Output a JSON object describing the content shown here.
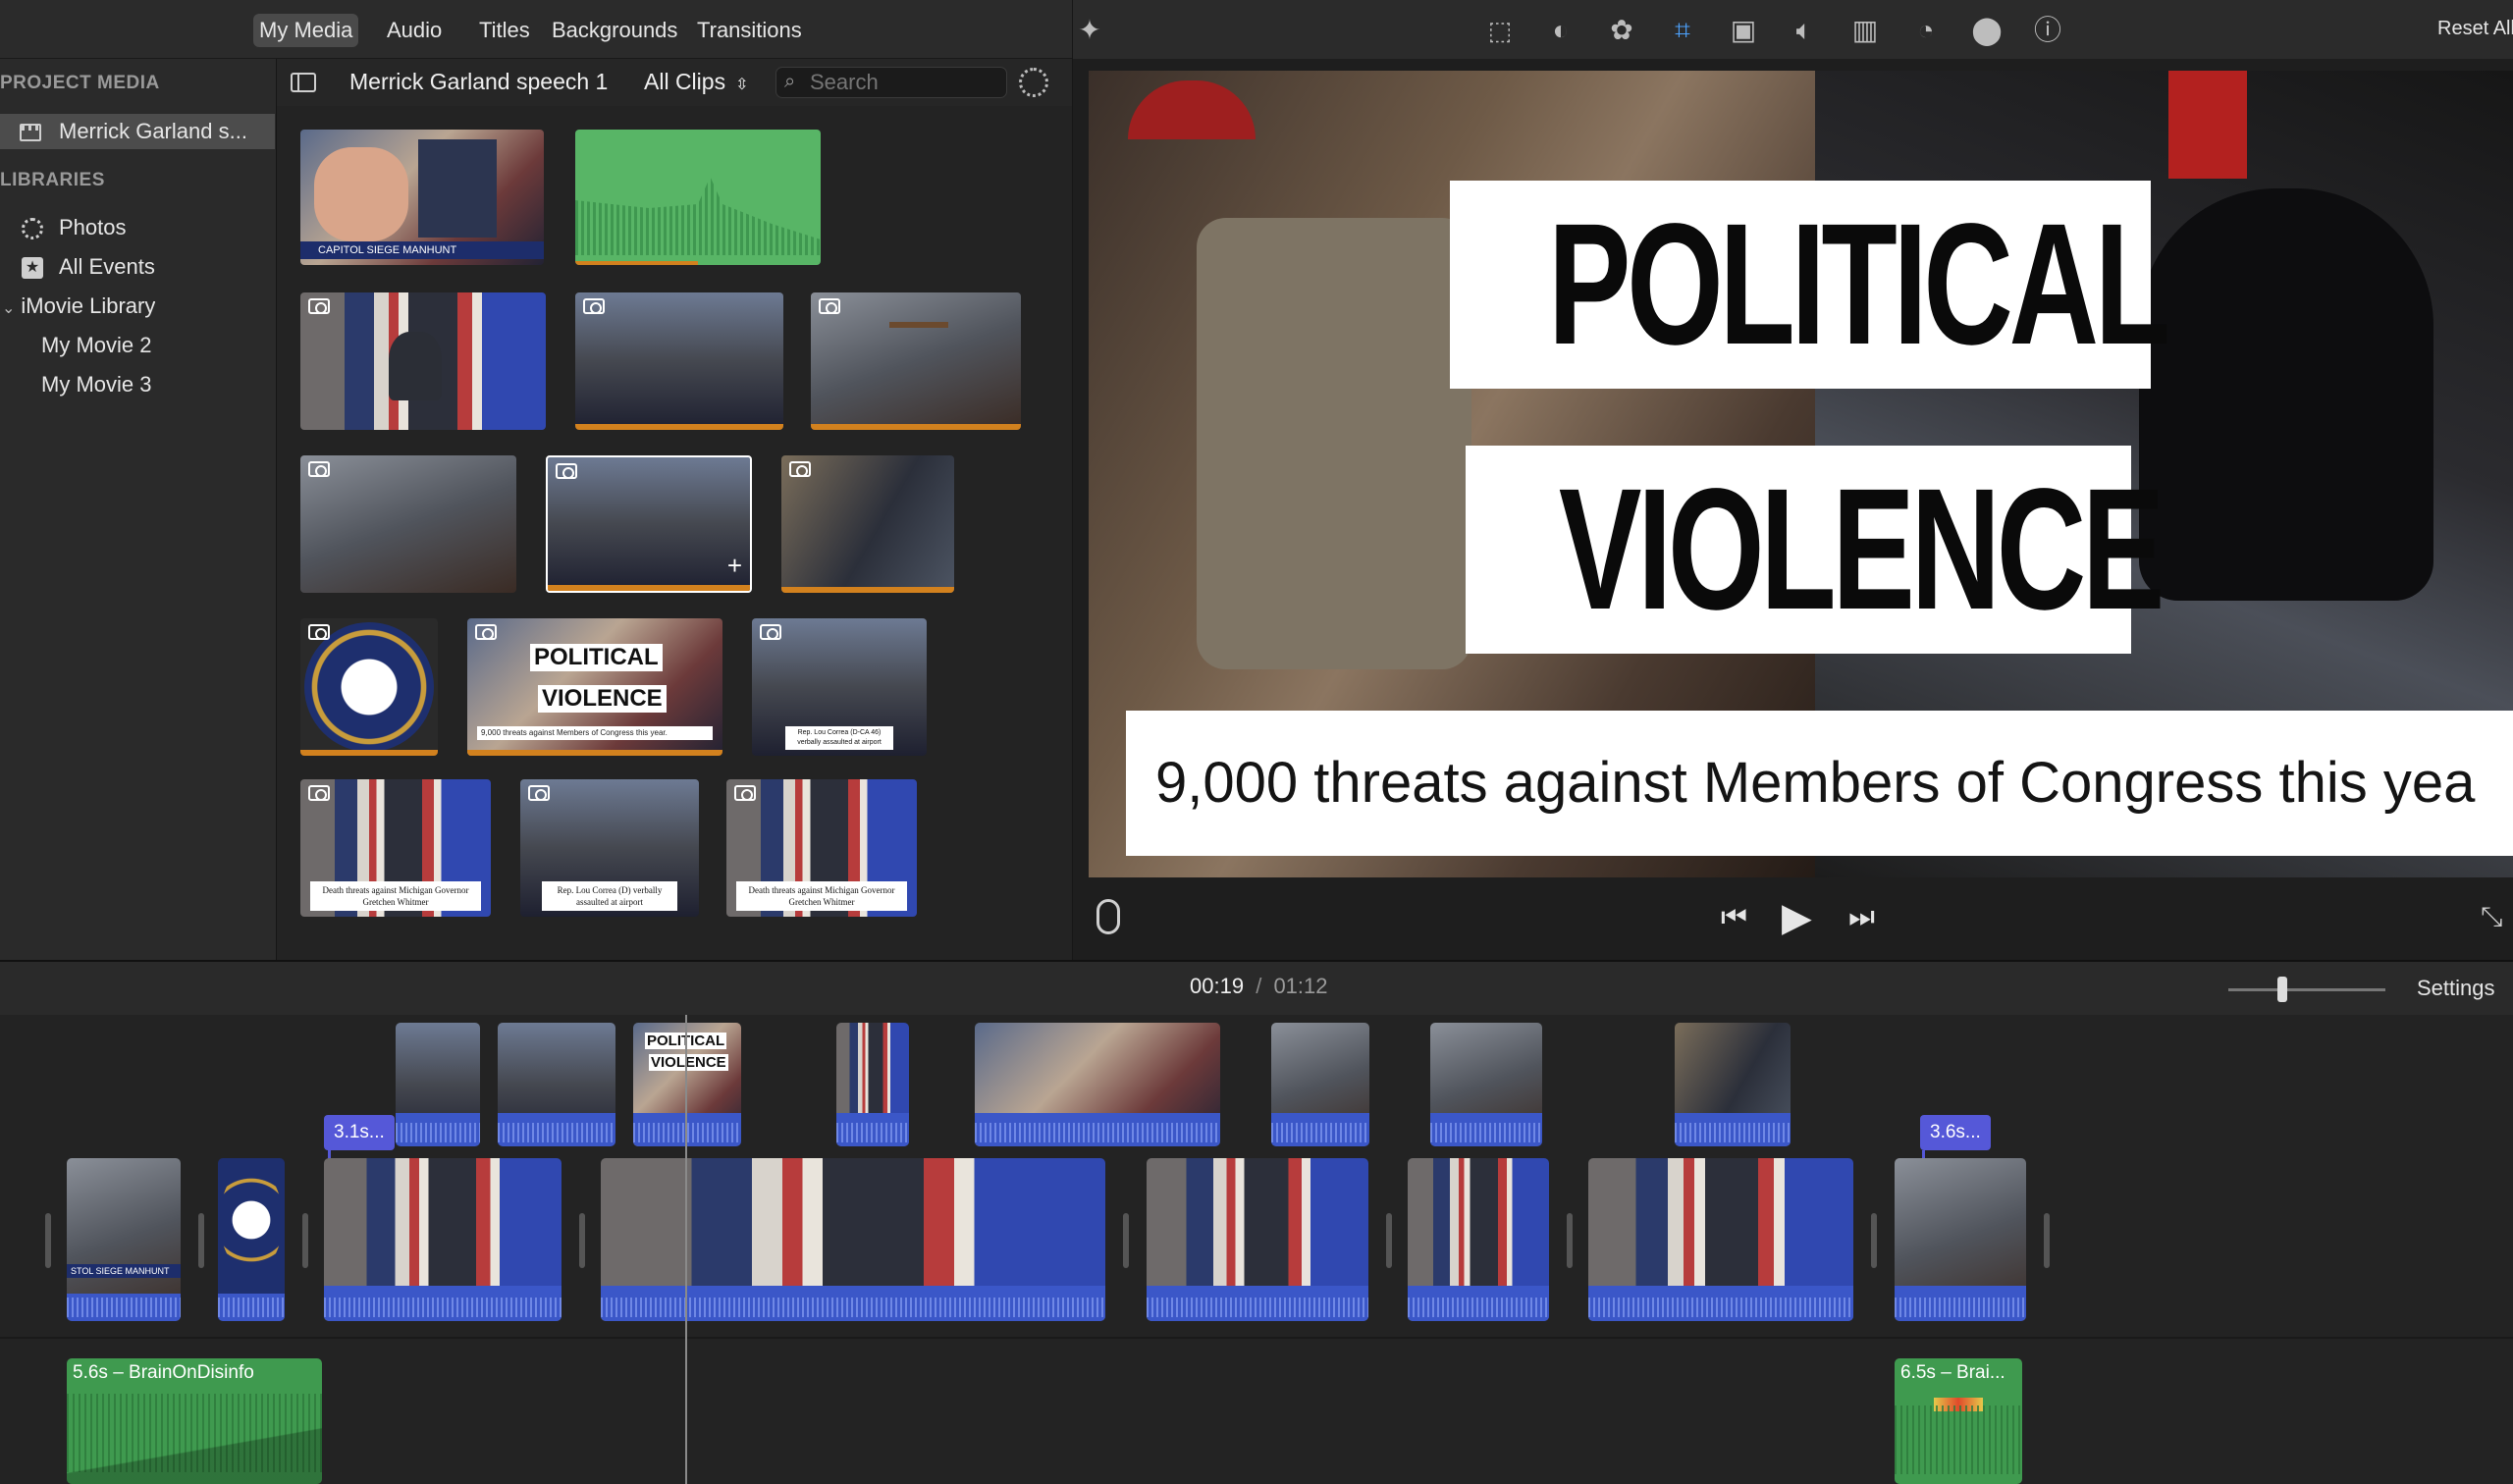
{
  "top_tabs": [
    "My Media",
    "Audio",
    "Titles",
    "Backgrounds",
    "Transitions"
  ],
  "sidebar": {
    "project_media_heading": "PROJECT MEDIA",
    "project_item": "Merrick Garland s...",
    "libraries_heading": "LIBRARIES",
    "items": [
      "Photos",
      "All Events",
      "iMovie Library",
      "My Movie 2",
      "My Movie 3"
    ]
  },
  "browser": {
    "title": "Merrick Garland speech 1",
    "filter": "All Clips",
    "search_placeholder": "Search",
    "thumb_texts": {
      "capitol_manhunt": "CAPITOL SIEGE MANHUNT",
      "political": "POLITICAL",
      "violence": "VIOLENCE",
      "threats_caption": "9,000 threats against Members of Congress this year.",
      "correa": "Rep. Lou Correa (D-CA 46) verbally assaulted at airport",
      "whitmer": "Death threats against Michigan Governor Gretchen Whitmer",
      "correa2": "Rep. Lou Correa (D) verbally assaulted at airport",
      "whitmer2": "Death threats against Michigan Governor Gretchen Whitmer"
    }
  },
  "viewer": {
    "reset_label": "Reset All",
    "title_line1": "POLITICAL",
    "title_line2": "VIOLENCE",
    "caption": "9,000 threats against Members of Congress this yea"
  },
  "timeline": {
    "current_time": "00:19",
    "separator": "/",
    "total_time": "01:12",
    "settings_label": "Settings",
    "label_left": "3.1s...",
    "label_right": "3.6s...",
    "audio_left": "5.6s – BrainOnDisinfo",
    "audio_right": "6.5s – Brai...",
    "clip_texts": {
      "political": "POLITICAL",
      "violence": "VIOLENCE",
      "manhunt": "STOL SIEGE MANHUNT"
    }
  }
}
